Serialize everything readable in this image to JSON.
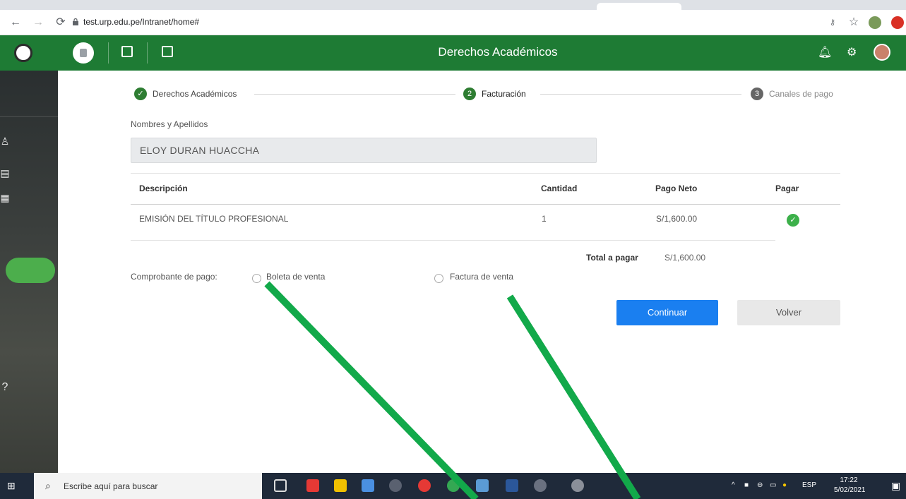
{
  "browser": {
    "url": "test.urp.edu.pe/Intranet/home#"
  },
  "header": {
    "title": "Derechos Académicos"
  },
  "stepper": {
    "steps": [
      {
        "number": "✓",
        "label": "Derechos Académicos",
        "state": "done"
      },
      {
        "number": "2",
        "label": "Facturación",
        "state": "active"
      },
      {
        "number": "3",
        "label": "Canales de pago",
        "state": "pending"
      }
    ]
  },
  "form": {
    "name_label": "Nombres y Apellidos",
    "name_value": "ELOY DURAN HUACCHA"
  },
  "table": {
    "headers": {
      "description": "Descripción",
      "quantity": "Cantidad",
      "net": "Pago Neto",
      "pay": "Pagar"
    },
    "rows": [
      {
        "description": "EMISIÓN DEL TÍTULO PROFESIONAL",
        "quantity": "1",
        "net": "S/1,600.00",
        "pay_checked": true
      }
    ],
    "total_label": "Total a pagar",
    "total_value": "S/1,600.00"
  },
  "voucher": {
    "label": "Comprobante de pago:",
    "options": [
      {
        "label": "Boleta de venta",
        "selected": false
      },
      {
        "label": "Factura de venta",
        "selected": false
      }
    ]
  },
  "actions": {
    "continue_label": "Continuar",
    "back_label": "Volver"
  },
  "taskbar": {
    "search_placeholder": "Escribe aquí para buscar",
    "lang": "ESP",
    "time": "17:22",
    "date": "5/02/2021"
  },
  "colors": {
    "header_green": "#1e7b34",
    "primary_blue": "#1a7ff0",
    "success_green": "#3cb04a",
    "annotation_green": "#12a94a"
  }
}
